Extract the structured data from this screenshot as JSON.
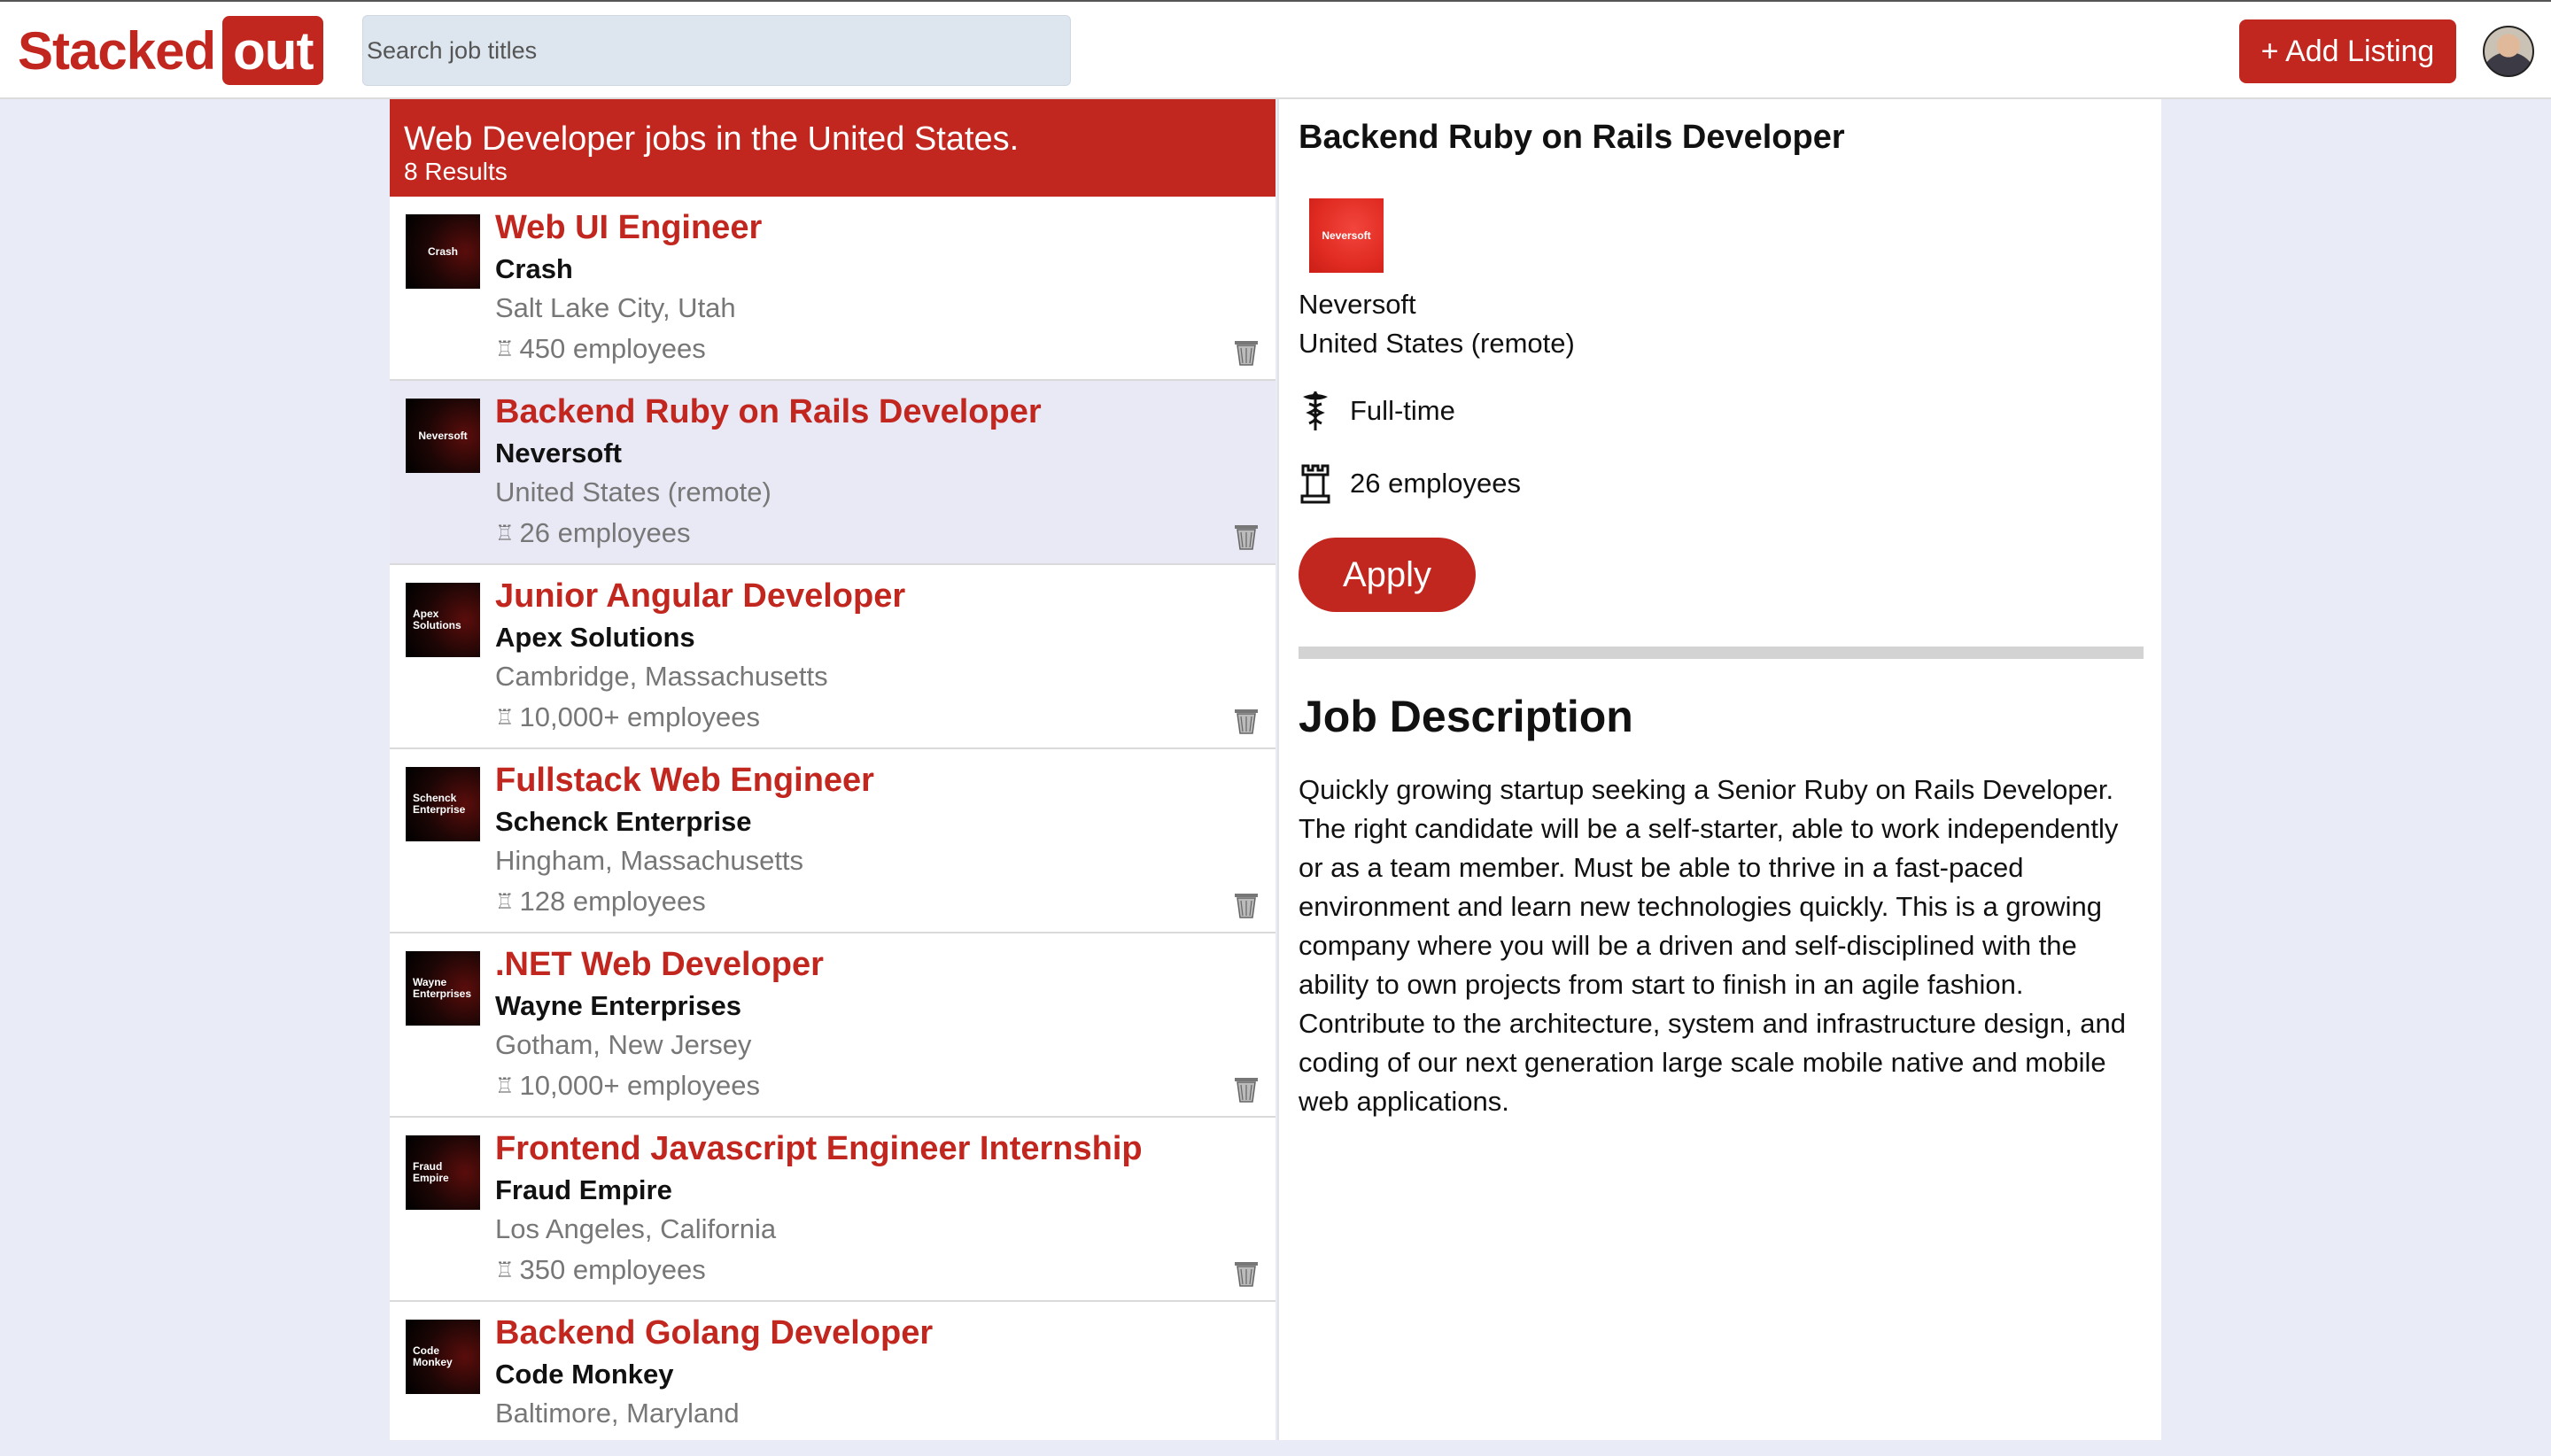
{
  "header": {
    "logo_part1": "Stacked",
    "logo_part2": "out",
    "search_placeholder": "Search job titles",
    "add_listing_label": "+ Add Listing"
  },
  "list": {
    "title": "Web Developer jobs in the United States.",
    "count_label": "8 Results",
    "jobs": [
      {
        "logo_text": "Crash",
        "title": "Web UI Engineer",
        "company": "Crash",
        "location": "Salt Lake City, Utah",
        "size": "450 employees"
      },
      {
        "logo_text": "Neversoft",
        "title": "Backend Ruby on Rails Developer",
        "company": "Neversoft",
        "location": "United States (remote)",
        "size": "26 employees"
      },
      {
        "logo_text": "Apex Solutions",
        "title": "Junior Angular Developer",
        "company": "Apex Solutions",
        "location": "Cambridge, Massachusetts",
        "size": "10,000+ employees"
      },
      {
        "logo_text": "Schenck Enterprise",
        "title": "Fullstack Web Engineer",
        "company": "Schenck Enterprise",
        "location": "Hingham, Massachusetts",
        "size": "128 employees"
      },
      {
        "logo_text": "Wayne Enterprises",
        "title": ".NET Web Developer",
        "company": "Wayne Enterprises",
        "location": "Gotham, New Jersey",
        "size": "10,000+ employees"
      },
      {
        "logo_text": "Fraud Empire",
        "title": "Frontend Javascript Engineer Internship",
        "company": "Fraud Empire",
        "location": "Los Angeles, California",
        "size": "350 employees"
      },
      {
        "logo_text": "Code Monkey",
        "title": "Backend Golang Developer",
        "company": "Code Monkey",
        "location": "Baltimore, Maryland",
        "size": ""
      }
    ]
  },
  "detail": {
    "title": "Backend Ruby on Rails Developer",
    "logo_text": "Neversoft",
    "company": "Neversoft",
    "location": "United States (remote)",
    "employment_type": "Full-time",
    "size": "26 employees",
    "apply_label": "Apply",
    "description_heading": "Job Description",
    "description": "Quickly growing startup seeking a Senior Ruby on Rails Developer. The right candidate will be a self-starter, able to work independently or as a team member. Must be able to thrive in a fast-paced environment and learn new technologies quickly. This is a growing company where you will be a driven and self-disciplined with the ability to own projects from start to finish in an agile fashion. Contribute to the architecture, system and infrastructure design, and coding of our next generation large scale mobile native and mobile web applications."
  },
  "colors": {
    "brand": "#c1261f",
    "selected_row": "#e9e9f6",
    "background": "#e9ecf7"
  },
  "icons": [
    "tower-icon",
    "trash-icon",
    "caduceus-icon",
    "avatar"
  ]
}
